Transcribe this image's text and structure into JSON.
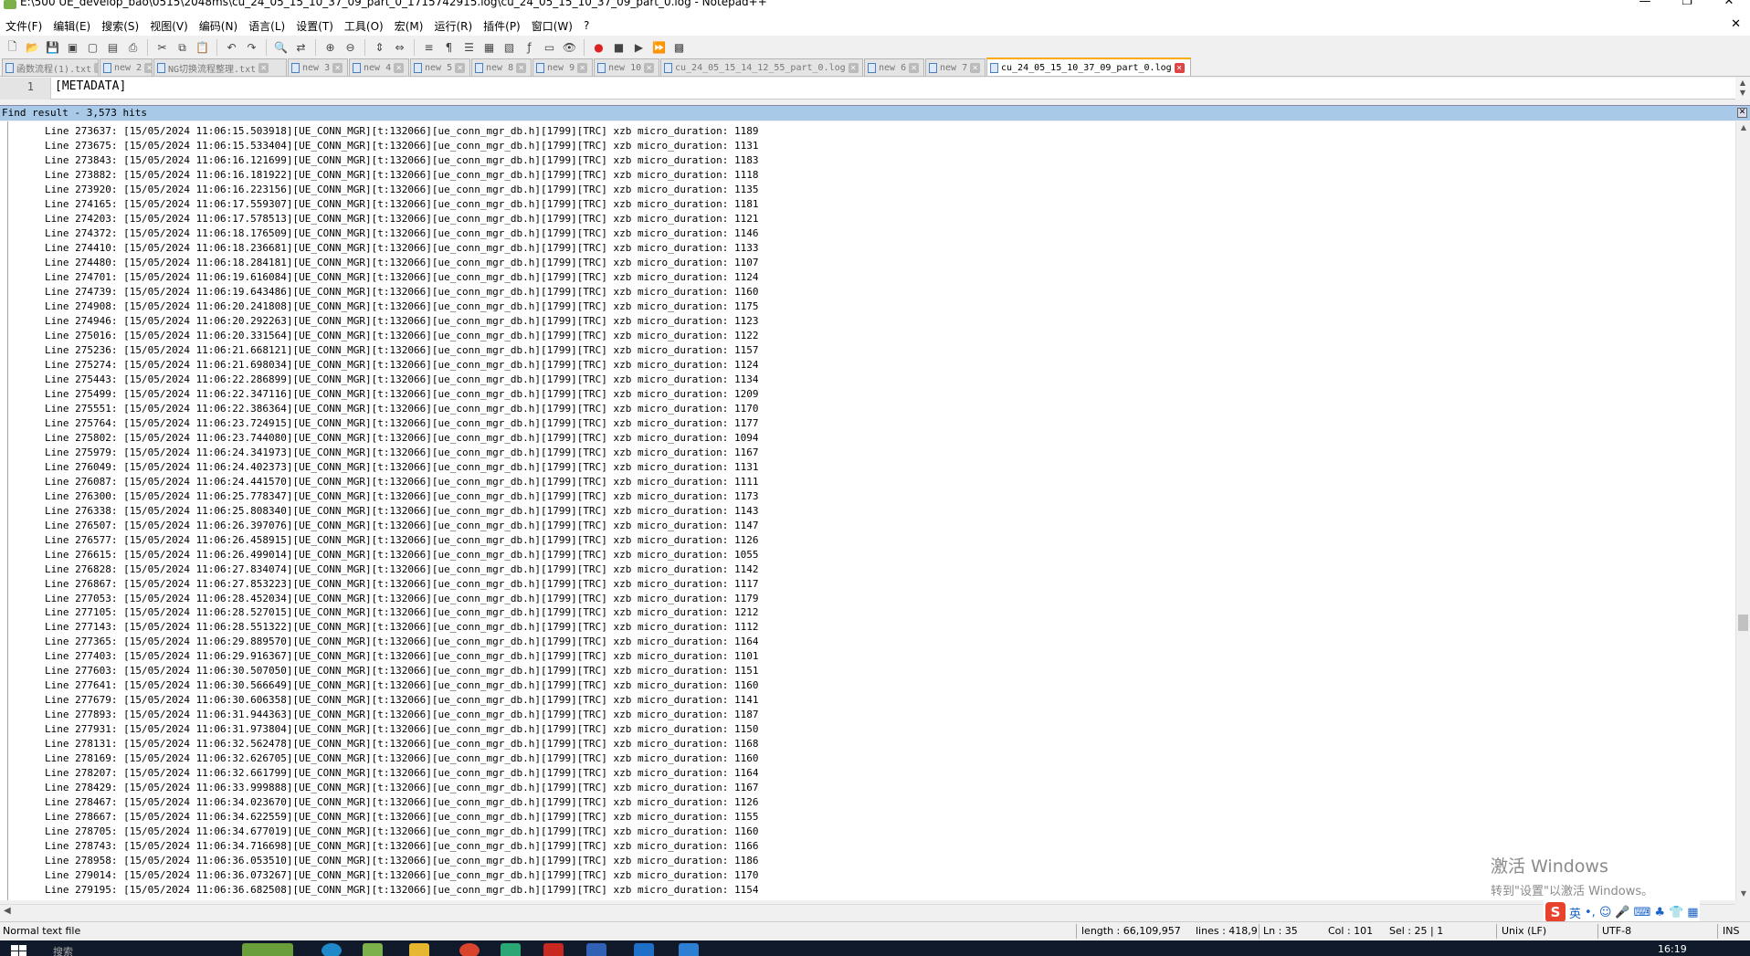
{
  "window": {
    "title": "E:\\500 UE_develop_bao\\0515\\2048ms\\cu_24_05_15_10_37_09_part_0_1715742915.log\\cu_24_05_15_10_37_09_part_0.log - Notepad++",
    "controls": [
      "—",
      "❐",
      "✕"
    ]
  },
  "menu": [
    "文件(F)",
    "编辑(E)",
    "搜索(S)",
    "视图(V)",
    "编码(N)",
    "语言(L)",
    "设置(T)",
    "工具(O)",
    "宏(M)",
    "运行(R)",
    "插件(P)",
    "窗口(W)",
    "?"
  ],
  "menu_close": "✕",
  "tabs": [
    {
      "label": "函数流程(1).txt",
      "active": false
    },
    {
      "label": "new 2",
      "active": false
    },
    {
      "label": "NG切换流程整理.txt",
      "active": false
    },
    {
      "label": "new 3",
      "active": false
    },
    {
      "label": "new 4",
      "active": false
    },
    {
      "label": "new 5",
      "active": false
    },
    {
      "label": "new 8",
      "active": false
    },
    {
      "label": "new 9",
      "active": false
    },
    {
      "label": "new 10",
      "active": false
    },
    {
      "label": "cu_24_05_15_14_12_55_part_0.log",
      "active": false
    },
    {
      "label": "new 6",
      "active": false
    },
    {
      "label": "new 7",
      "active": false
    },
    {
      "label": "cu_24_05_15_10_37_09_part_0.log",
      "active": true
    }
  ],
  "editor": {
    "line_number": "1",
    "line_text": "[METADATA]"
  },
  "find_result": {
    "header": "Find result - 3,573 hits"
  },
  "results": [
    "Line 273637: [15/05/2024 11:06:15.503918][UE_CONN_MGR][t:132066][ue_conn_mgr_db.h][1799][TRC] xzb micro_duration: 1189",
    "Line 273675: [15/05/2024 11:06:15.533404][UE_CONN_MGR][t:132066][ue_conn_mgr_db.h][1799][TRC] xzb micro_duration: 1131",
    "Line 273843: [15/05/2024 11:06:16.121699][UE_CONN_MGR][t:132066][ue_conn_mgr_db.h][1799][TRC] xzb micro_duration: 1183",
    "Line 273882: [15/05/2024 11:06:16.181922][UE_CONN_MGR][t:132066][ue_conn_mgr_db.h][1799][TRC] xzb micro_duration: 1118",
    "Line 273920: [15/05/2024 11:06:16.223156][UE_CONN_MGR][t:132066][ue_conn_mgr_db.h][1799][TRC] xzb micro_duration: 1135",
    "Line 274165: [15/05/2024 11:06:17.559307][UE_CONN_MGR][t:132066][ue_conn_mgr_db.h][1799][TRC] xzb micro_duration: 1181",
    "Line 274203: [15/05/2024 11:06:17.578513][UE_CONN_MGR][t:132066][ue_conn_mgr_db.h][1799][TRC] xzb micro_duration: 1121",
    "Line 274372: [15/05/2024 11:06:18.176509][UE_CONN_MGR][t:132066][ue_conn_mgr_db.h][1799][TRC] xzb micro_duration: 1146",
    "Line 274410: [15/05/2024 11:06:18.236681][UE_CONN_MGR][t:132066][ue_conn_mgr_db.h][1799][TRC] xzb micro_duration: 1133",
    "Line 274480: [15/05/2024 11:06:18.284181][UE_CONN_MGR][t:132066][ue_conn_mgr_db.h][1799][TRC] xzb micro_duration: 1107",
    "Line 274701: [15/05/2024 11:06:19.616084][UE_CONN_MGR][t:132066][ue_conn_mgr_db.h][1799][TRC] xzb micro_duration: 1124",
    "Line 274739: [15/05/2024 11:06:19.643486][UE_CONN_MGR][t:132066][ue_conn_mgr_db.h][1799][TRC] xzb micro_duration: 1160",
    "Line 274908: [15/05/2024 11:06:20.241808][UE_CONN_MGR][t:132066][ue_conn_mgr_db.h][1799][TRC] xzb micro_duration: 1175",
    "Line 274946: [15/05/2024 11:06:20.292263][UE_CONN_MGR][t:132066][ue_conn_mgr_db.h][1799][TRC] xzb micro_duration: 1123",
    "Line 275016: [15/05/2024 11:06:20.331564][UE_CONN_MGR][t:132066][ue_conn_mgr_db.h][1799][TRC] xzb micro_duration: 1122",
    "Line 275236: [15/05/2024 11:06:21.668121][UE_CONN_MGR][t:132066][ue_conn_mgr_db.h][1799][TRC] xzb micro_duration: 1157",
    "Line 275274: [15/05/2024 11:06:21.698034][UE_CONN_MGR][t:132066][ue_conn_mgr_db.h][1799][TRC] xzb micro_duration: 1124",
    "Line 275443: [15/05/2024 11:06:22.286899][UE_CONN_MGR][t:132066][ue_conn_mgr_db.h][1799][TRC] xzb micro_duration: 1134",
    "Line 275499: [15/05/2024 11:06:22.347116][UE_CONN_MGR][t:132066][ue_conn_mgr_db.h][1799][TRC] xzb micro_duration: 1209",
    "Line 275551: [15/05/2024 11:06:22.386364][UE_CONN_MGR][t:132066][ue_conn_mgr_db.h][1799][TRC] xzb micro_duration: 1170",
    "Line 275764: [15/05/2024 11:06:23.724915][UE_CONN_MGR][t:132066][ue_conn_mgr_db.h][1799][TRC] xzb micro_duration: 1177",
    "Line 275802: [15/05/2024 11:06:23.744080][UE_CONN_MGR][t:132066][ue_conn_mgr_db.h][1799][TRC] xzb micro_duration: 1094",
    "Line 275979: [15/05/2024 11:06:24.341973][UE_CONN_MGR][t:132066][ue_conn_mgr_db.h][1799][TRC] xzb micro_duration: 1167",
    "Line 276049: [15/05/2024 11:06:24.402373][UE_CONN_MGR][t:132066][ue_conn_mgr_db.h][1799][TRC] xzb micro_duration: 1131",
    "Line 276087: [15/05/2024 11:06:24.441570][UE_CONN_MGR][t:132066][ue_conn_mgr_db.h][1799][TRC] xzb micro_duration: 1111",
    "Line 276300: [15/05/2024 11:06:25.778347][UE_CONN_MGR][t:132066][ue_conn_mgr_db.h][1799][TRC] xzb micro_duration: 1173",
    "Line 276338: [15/05/2024 11:06:25.808340][UE_CONN_MGR][t:132066][ue_conn_mgr_db.h][1799][TRC] xzb micro_duration: 1143",
    "Line 276507: [15/05/2024 11:06:26.397076][UE_CONN_MGR][t:132066][ue_conn_mgr_db.h][1799][TRC] xzb micro_duration: 1147",
    "Line 276577: [15/05/2024 11:06:26.458915][UE_CONN_MGR][t:132066][ue_conn_mgr_db.h][1799][TRC] xzb micro_duration: 1126",
    "Line 276615: [15/05/2024 11:06:26.499014][UE_CONN_MGR][t:132066][ue_conn_mgr_db.h][1799][TRC] xzb micro_duration: 1055",
    "Line 276828: [15/05/2024 11:06:27.834074][UE_CONN_MGR][t:132066][ue_conn_mgr_db.h][1799][TRC] xzb micro_duration: 1142",
    "Line 276867: [15/05/2024 11:06:27.853223][UE_CONN_MGR][t:132066][ue_conn_mgr_db.h][1799][TRC] xzb micro_duration: 1117",
    "Line 277053: [15/05/2024 11:06:28.452034][UE_CONN_MGR][t:132066][ue_conn_mgr_db.h][1799][TRC] xzb micro_duration: 1179",
    "Line 277105: [15/05/2024 11:06:28.527015][UE_CONN_MGR][t:132066][ue_conn_mgr_db.h][1799][TRC] xzb micro_duration: 1212",
    "Line 277143: [15/05/2024 11:06:28.551322][UE_CONN_MGR][t:132066][ue_conn_mgr_db.h][1799][TRC] xzb micro_duration: 1112",
    "Line 277365: [15/05/2024 11:06:29.889570][UE_CONN_MGR][t:132066][ue_conn_mgr_db.h][1799][TRC] xzb micro_duration: 1164",
    "Line 277403: [15/05/2024 11:06:29.916367][UE_CONN_MGR][t:132066][ue_conn_mgr_db.h][1799][TRC] xzb micro_duration: 1101",
    "Line 277603: [15/05/2024 11:06:30.507050][UE_CONN_MGR][t:132066][ue_conn_mgr_db.h][1799][TRC] xzb micro_duration: 1151",
    "Line 277641: [15/05/2024 11:06:30.566649][UE_CONN_MGR][t:132066][ue_conn_mgr_db.h][1799][TRC] xzb micro_duration: 1160",
    "Line 277679: [15/05/2024 11:06:30.606358][UE_CONN_MGR][t:132066][ue_conn_mgr_db.h][1799][TRC] xzb micro_duration: 1141",
    "Line 277893: [15/05/2024 11:06:31.944363][UE_CONN_MGR][t:132066][ue_conn_mgr_db.h][1799][TRC] xzb micro_duration: 1187",
    "Line 277931: [15/05/2024 11:06:31.973804][UE_CONN_MGR][t:132066][ue_conn_mgr_db.h][1799][TRC] xzb micro_duration: 1150",
    "Line 278131: [15/05/2024 11:06:32.562478][UE_CONN_MGR][t:132066][ue_conn_mgr_db.h][1799][TRC] xzb micro_duration: 1168",
    "Line 278169: [15/05/2024 11:06:32.626705][UE_CONN_MGR][t:132066][ue_conn_mgr_db.h][1799][TRC] xzb micro_duration: 1160",
    "Line 278207: [15/05/2024 11:06:32.661799][UE_CONN_MGR][t:132066][ue_conn_mgr_db.h][1799][TRC] xzb micro_duration: 1164",
    "Line 278429: [15/05/2024 11:06:33.999888][UE_CONN_MGR][t:132066][ue_conn_mgr_db.h][1799][TRC] xzb micro_duration: 1167",
    "Line 278467: [15/05/2024 11:06:34.023670][UE_CONN_MGR][t:132066][ue_conn_mgr_db.h][1799][TRC] xzb micro_duration: 1126",
    "Line 278667: [15/05/2024 11:06:34.622559][UE_CONN_MGR][t:132066][ue_conn_mgr_db.h][1799][TRC] xzb micro_duration: 1155",
    "Line 278705: [15/05/2024 11:06:34.677019][UE_CONN_MGR][t:132066][ue_conn_mgr_db.h][1799][TRC] xzb micro_duration: 1160",
    "Line 278743: [15/05/2024 11:06:34.716698][UE_CONN_MGR][t:132066][ue_conn_mgr_db.h][1799][TRC] xzb micro_duration: 1166",
    "Line 278958: [15/05/2024 11:06:36.053510][UE_CONN_MGR][t:132066][ue_conn_mgr_db.h][1799][TRC] xzb micro_duration: 1186",
    "Line 279014: [15/05/2024 11:06:36.073267][UE_CONN_MGR][t:132066][ue_conn_mgr_db.h][1799][TRC] xzb micro_duration: 1170",
    "Line 279195: [15/05/2024 11:06:36.682508][UE_CONN_MGR][t:132066][ue_conn_mgr_db.h][1799][TRC] xzb micro_duration: 1154"
  ],
  "watermark": {
    "line1": "激活 Windows",
    "line2": "转到\"设置\"以激活 Windows。"
  },
  "ime": {
    "logo": "S",
    "lang": "英"
  },
  "status": {
    "file_type": "Normal text file",
    "length": "length : 66,109,957",
    "lines": "lines : 418,9",
    "ln": "Ln : 35",
    "col": "Col : 101",
    "sel": "Sel : 25 | 1",
    "eol": "Unix (LF)",
    "encoding": "UTF-8",
    "mode": "INS"
  },
  "taskbar": {
    "search_placeholder": "搜索",
    "clock": "16:19"
  },
  "colors": {
    "find_header": "#a9c9e9",
    "active_tab_accent": "#ffaa00"
  }
}
